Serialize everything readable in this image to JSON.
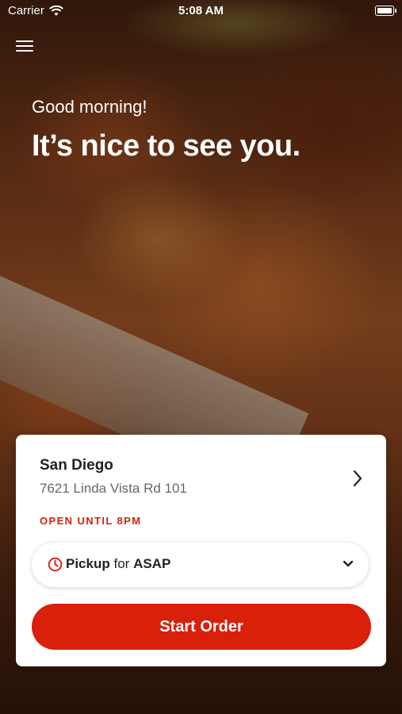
{
  "status_bar": {
    "carrier": "Carrier",
    "time": "5:08 AM"
  },
  "icons": {
    "wifi": "wifi-icon",
    "battery": "battery-icon",
    "menu": "hamburger-menu-icon",
    "chevron_right": "chevron-right-icon",
    "clock": "clock-icon",
    "chevron_down": "chevron-down-icon"
  },
  "hero": {
    "greeting": "Good morning!",
    "headline": "It’s nice to see you."
  },
  "store": {
    "name": "San Diego",
    "address": "7621 Linda Vista Rd 101",
    "hours": "OPEN UNTIL 8PM"
  },
  "order_mode": {
    "method": "Pickup",
    "connector": "for",
    "time": "ASAP"
  },
  "actions": {
    "start_order": "Start Order"
  },
  "colors": {
    "accent": "#d8200a"
  }
}
